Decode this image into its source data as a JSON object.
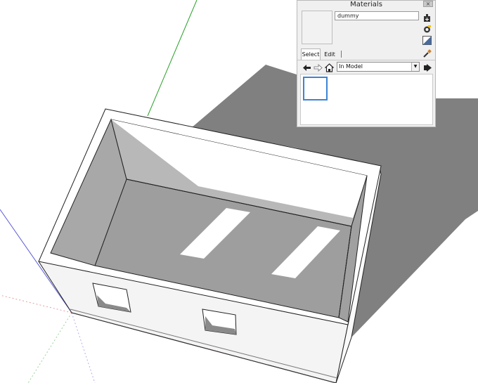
{
  "panel": {
    "title": "Materials",
    "close_glyph": "×",
    "material_name": "dummy",
    "tabs": [
      {
        "label": "Select",
        "active": true
      },
      {
        "label": "Edit",
        "active": false
      }
    ],
    "collection": {
      "selected": "In Model",
      "arrow_glyph": "▼"
    },
    "icons": {
      "create": "create-material-icon",
      "display_secondary": "paint-bucket-icon",
      "default": "default-material-icon",
      "sample": "eyedropper-icon",
      "back": "back-arrow-icon",
      "forward": "forward-arrow-icon",
      "home": "home-icon",
      "details": "details-arrow-icon"
    }
  },
  "colors": {
    "green_axis": "#2aa12a",
    "blue_axis": "#5a5ad8",
    "red_axis": "#d04040",
    "shadow": "#808080",
    "interior": "#9e9e9e",
    "selection_blue": "#3c84d4"
  }
}
